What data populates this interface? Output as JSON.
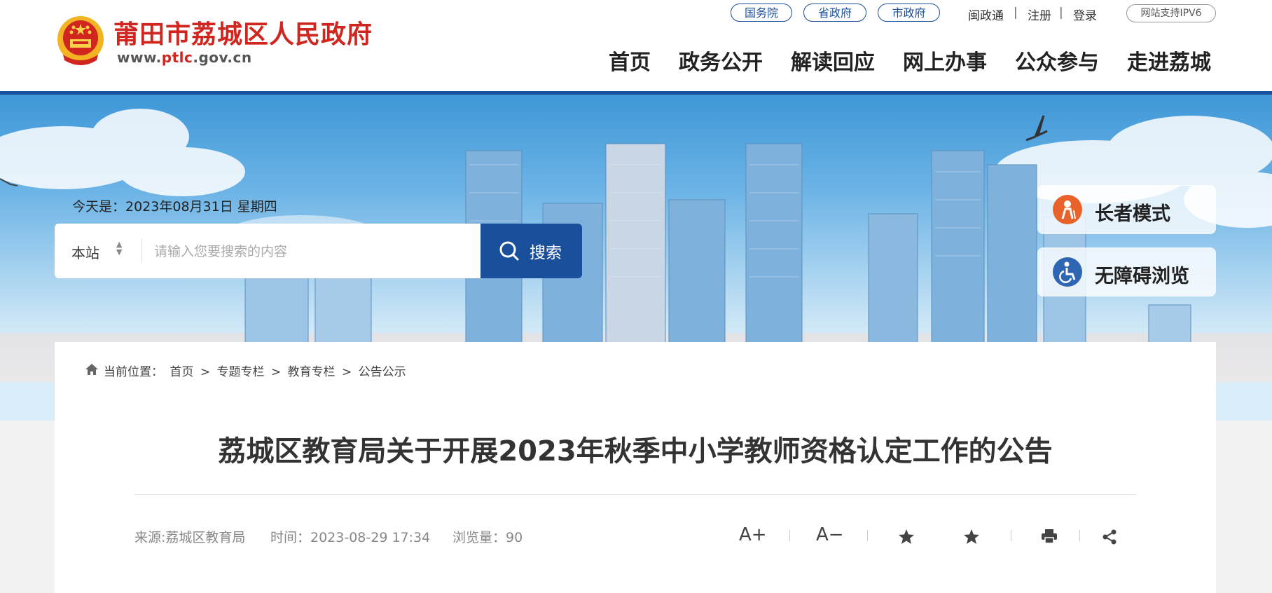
{
  "header": {
    "site_name": "莆田市荔城区人民政府",
    "url_prefix": "www.",
    "url_highlight": "ptlc",
    "url_suffix": ".gov.cn",
    "top_pills": [
      "国务院",
      "省政府",
      "市政府"
    ],
    "top_links": [
      "闽政通",
      "注册",
      "登录"
    ],
    "ipv6_label": "网站支持IPV6",
    "nav": [
      "首页",
      "政务公开",
      "解读回应",
      "网上办事",
      "公众参与",
      "走进荔城"
    ]
  },
  "banner": {
    "date_text": "今天是：2023年08月31日 星期四",
    "search_scope": "本站",
    "search_placeholder": "请输入您要搜索的内容",
    "search_button": "搜索",
    "elder_mode": "长者模式",
    "accessible_mode": "无障碍浏览"
  },
  "breadcrumb": {
    "prefix": "当前位置：",
    "items": [
      "首页",
      "专题专栏",
      "教育专栏",
      "公告公示"
    ],
    "separator": ">"
  },
  "article": {
    "title": "荔城区教育局关于开展2023年秋季中小学教师资格认定工作的公告",
    "source": "来源:荔城区教育局",
    "time": "时间：2023-08-29 17:34",
    "views": "浏览量：90"
  },
  "toolbar": {
    "font_increase": "A+",
    "font_decrease": "A−",
    "icons": [
      "star-icon",
      "star-icon",
      "print-icon",
      "share-icon"
    ]
  },
  "colors": {
    "brand_blue": "#1a4f9c",
    "brand_red": "#d0261f",
    "elder_orange": "#e8632b",
    "accessible_blue": "#2f66b3"
  }
}
